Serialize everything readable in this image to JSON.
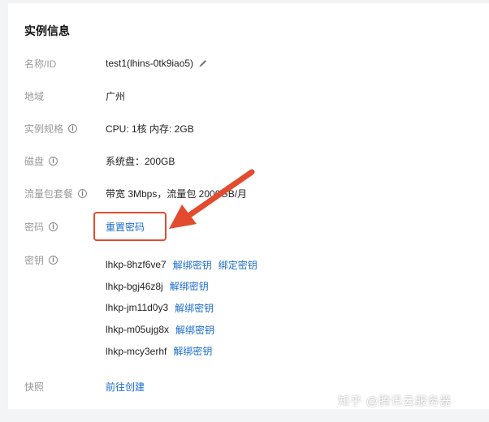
{
  "card": {
    "title": "实例信息"
  },
  "fields": {
    "name": {
      "label": "名称/ID",
      "value": "test1(lhins-0tk9iao5)"
    },
    "region": {
      "label": "地域",
      "value": "广州"
    },
    "spec": {
      "label": "实例规格",
      "value": "CPU: 1核 内存: 2GB"
    },
    "disk": {
      "label": "磁盘",
      "value": "系统盘：200GB"
    },
    "traffic": {
      "label": "流量包套餐",
      "value": "带宽 3Mbps，流量包 2000GB/月"
    },
    "password": {
      "label": "密码",
      "action": "重置密码"
    },
    "keys": {
      "label": "密钥",
      "items": [
        {
          "name": "lhkp-8hzf6ve7",
          "unbind": "解绑密钥",
          "bind": "绑定密钥"
        },
        {
          "name": "lhkp-bgj46z8j",
          "unbind": "解绑密钥"
        },
        {
          "name": "lhkp-jm11d0y3",
          "unbind": "解绑密钥"
        },
        {
          "name": "lhkp-m05ujg8x",
          "unbind": "解绑密钥"
        },
        {
          "name": "lhkp-mcy3erhf",
          "unbind": "解绑密钥"
        }
      ]
    },
    "snapshot": {
      "label": "快照",
      "action": "前往创建"
    }
  },
  "watermark": "知乎 @腾讯云服务器",
  "colors": {
    "link": "#1c6dd0",
    "highlight": "#e24b2f",
    "label": "#9a9a9a"
  },
  "icons": {
    "info": "info-circle-icon",
    "edit": "pencil-icon",
    "pointer": "red-arrow-annotation"
  }
}
